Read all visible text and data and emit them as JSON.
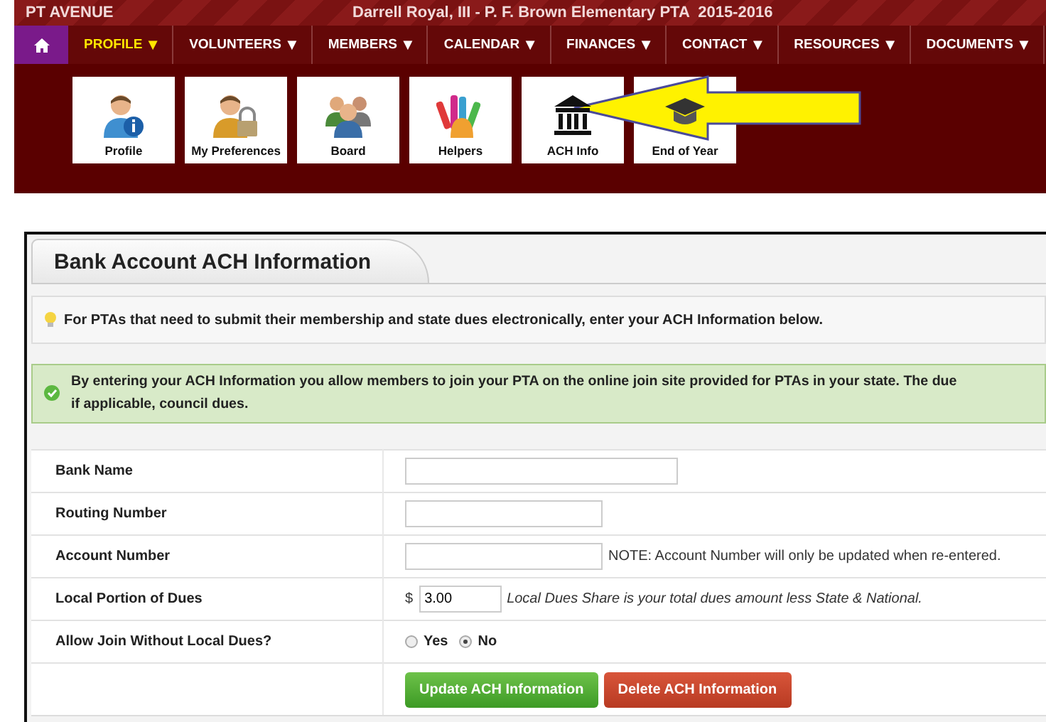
{
  "header": {
    "brand": "PT AVENUE",
    "title": "Darrell Royal, III - P. F. Brown Elementary PTA  2015-2016"
  },
  "nav": [
    {
      "label": "PROFILE",
      "selected": true
    },
    {
      "label": "VOLUNTEERS",
      "selected": false
    },
    {
      "label": "MEMBERS",
      "selected": false
    },
    {
      "label": "CALENDAR",
      "selected": false
    },
    {
      "label": "FINANCES",
      "selected": false
    },
    {
      "label": "CONTACT",
      "selected": false
    },
    {
      "label": "RESOURCES",
      "selected": false
    },
    {
      "label": "DOCUMENTS",
      "selected": false
    }
  ],
  "nav_caret": "▼",
  "tiles": [
    {
      "label": "Profile"
    },
    {
      "label": "My Preferences"
    },
    {
      "label": "Board"
    },
    {
      "label": "Helpers"
    },
    {
      "label": "ACH Info"
    },
    {
      "label": "End of Year"
    }
  ],
  "panel": {
    "tab": "Bank Account ACH Information",
    "info": "For PTAs that need to submit their membership and state dues electronically, enter your ACH Information below.",
    "notice": [
      "By entering your ACH Information you allow members to join your PTA on the online join site provided for PTAs in your state. The due",
      "if applicable, council dues."
    ]
  },
  "form": {
    "rows": [
      {
        "kind": "text",
        "label": "Bank Name",
        "wide": true
      },
      {
        "kind": "text",
        "label": "Routing Number"
      },
      {
        "kind": "text",
        "label": "Account Number",
        "note": "NOTE: Account Number will only be updated when re-entered."
      },
      {
        "kind": "money",
        "label": "Local Portion of Dues",
        "prefix": "$",
        "value": "3.00",
        "note": "Local Dues Share is your total dues amount less State & National."
      },
      {
        "kind": "radio",
        "label": "Allow Join Without Local Dues?",
        "options": [
          {
            "label": "Yes",
            "selected": false
          },
          {
            "label": "No",
            "selected": true
          }
        ]
      }
    ],
    "buttons": [
      {
        "label": "Update ACH Information",
        "kind": "primary"
      },
      {
        "label": "Delete ACH Information",
        "kind": "danger"
      }
    ]
  }
}
